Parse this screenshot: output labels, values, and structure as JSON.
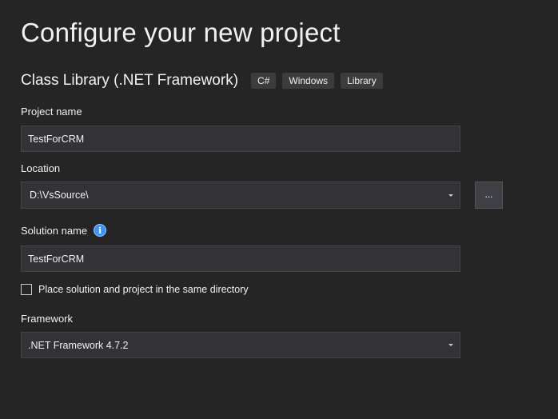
{
  "header": {
    "title": "Configure your new project"
  },
  "template": {
    "name": "Class Library (.NET Framework)",
    "tags": [
      "C#",
      "Windows",
      "Library"
    ]
  },
  "project_name": {
    "label": "Project name",
    "value": "TestForCRM"
  },
  "location": {
    "label": "Location",
    "value": "D:\\VsSource\\",
    "browse_label": "..."
  },
  "solution_name": {
    "label": "Solution name",
    "value": "TestForCRM",
    "info_icon": "i"
  },
  "same_directory": {
    "label": "Place solution and project in the same directory",
    "checked": false
  },
  "framework": {
    "label": "Framework",
    "value": ".NET Framework 4.7.2"
  }
}
